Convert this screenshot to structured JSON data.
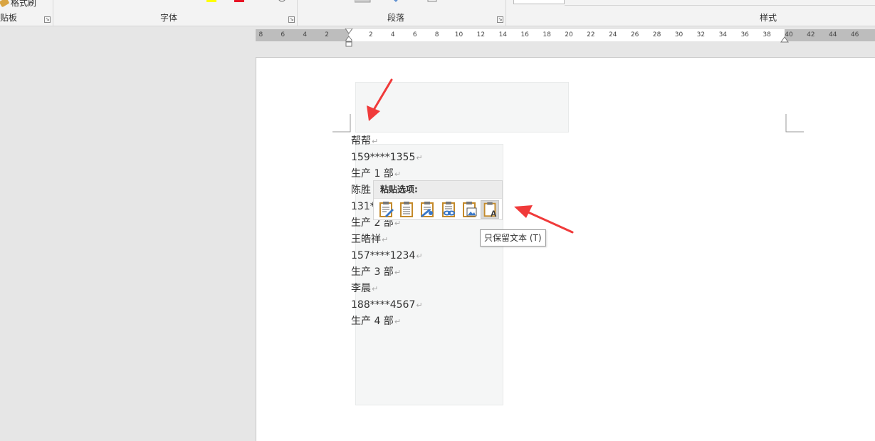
{
  "ribbon": {
    "clipboard": {
      "format_painter": "格式刷",
      "label": "贴板"
    },
    "font": {
      "label": "字体"
    },
    "paragraph": {
      "label": "段落"
    },
    "styles": {
      "label": "样式"
    }
  },
  "ruler": {
    "ticks": [
      "8",
      "6",
      "4",
      "2",
      "2",
      "4",
      "6",
      "8",
      "10",
      "12",
      "14",
      "16",
      "18",
      "20",
      "22",
      "24",
      "26",
      "28",
      "30",
      "32",
      "34",
      "36",
      "38",
      "40",
      "42",
      "44",
      "46"
    ]
  },
  "document": {
    "lines": [
      {
        "text": "帮帮"
      },
      {
        "text": "159****1355"
      },
      {
        "text": "生产 1 部"
      },
      {
        "text": "陈胜"
      },
      {
        "text": "131*"
      },
      {
        "text": "生产 2 部"
      },
      {
        "text": "王皓祥"
      },
      {
        "text": "157****1234"
      },
      {
        "text": "生产 3 部"
      },
      {
        "text": "李晨"
      },
      {
        "text": "188****4567"
      },
      {
        "text": "生产 4 部"
      }
    ],
    "return_mark": "↵"
  },
  "paste_menu": {
    "title": "粘贴选项:",
    "options": [
      {
        "name": "keep-source-formatting",
        "icon": "paste-keep-source-icon"
      },
      {
        "name": "merge-formatting",
        "icon": "paste-merge-icon"
      },
      {
        "name": "use-destination-styles",
        "icon": "paste-dest-styles-icon"
      },
      {
        "name": "link",
        "icon": "paste-link-icon"
      },
      {
        "name": "picture",
        "icon": "paste-picture-icon"
      },
      {
        "name": "keep-text-only",
        "icon": "paste-text-only-icon",
        "selected": true
      }
    ],
    "tooltip": "只保留文本 (T)"
  },
  "colors": {
    "arrow": "#f03a3a",
    "highlight_yellow": "#ffff00",
    "font_red": "#e81123"
  }
}
